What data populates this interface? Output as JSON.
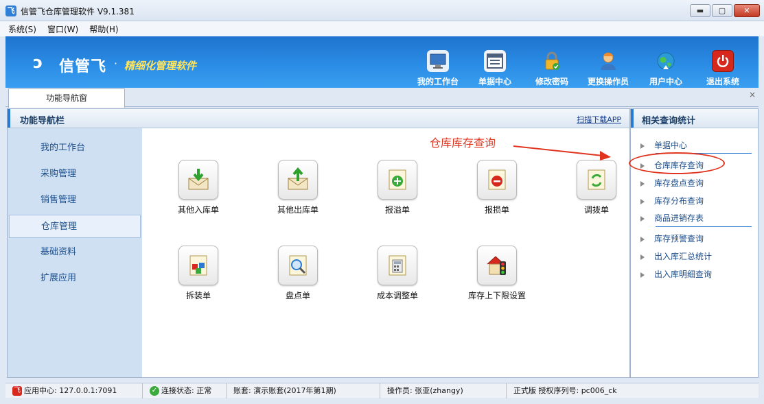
{
  "window": {
    "title": "信管飞仓库管理软件 V9.1.381",
    "controls": {
      "minimize": "▬",
      "maximize": "▢",
      "close": "✕"
    }
  },
  "menu": [
    "系统(S)",
    "窗口(W)",
    "帮助(H)"
  ],
  "banner": {
    "logo": "信管飞",
    "dot": "·",
    "slogan": "精细化管理软件",
    "tools": [
      {
        "label": "我的工作台",
        "icon": "monitor-icon",
        "color": "#3a78c4"
      },
      {
        "label": "单据中心",
        "icon": "document-list-icon",
        "color": "#4c5f7c"
      },
      {
        "label": "修改密码",
        "icon": "lock-icon",
        "color": "#f0b62a"
      },
      {
        "label": "更换操作员",
        "icon": "user-icon",
        "color": "#f08a2a"
      },
      {
        "label": "用户中心",
        "icon": "globe-icon",
        "color": "#2a9bd8"
      },
      {
        "label": "退出系统",
        "icon": "power-icon",
        "color": "#d7281e"
      }
    ]
  },
  "tabs": {
    "active": "功能导航窗",
    "close": "×"
  },
  "nav_panel": {
    "title": "功能导航栏",
    "scan_link": "扫描下载APP",
    "sidebar": [
      "我的工作台",
      "采购管理",
      "销售管理",
      "仓库管理",
      "基础资料",
      "扩展应用"
    ],
    "active_index": 3,
    "functions": [
      {
        "label": "其他入库单",
        "icon": "inbound-icon"
      },
      {
        "label": "其他出库单",
        "icon": "outbound-icon"
      },
      {
        "label": "报溢单",
        "icon": "overflow-icon"
      },
      {
        "label": "报损单",
        "icon": "loss-icon"
      },
      {
        "label": "调拨单",
        "icon": "transfer-icon"
      },
      {
        "label": "拆装单",
        "icon": "assembly-icon"
      },
      {
        "label": "盘点单",
        "icon": "inventory-count-icon"
      },
      {
        "label": "成本调整单",
        "icon": "cost-adjust-icon"
      },
      {
        "label": "库存上下限设置",
        "icon": "stock-limit-icon"
      }
    ]
  },
  "annotation": "仓库库存查询",
  "query_panel": {
    "title": "相关查询统计",
    "links": [
      "单据中心",
      "仓库库存查询",
      "库存盘点查询",
      "库存分布查询",
      "商品进销存表",
      "库存预警查询",
      "出入库汇总统计",
      "出入库明细查询"
    ]
  },
  "status": {
    "app_center": "应用中心: 127.0.0.1:7091",
    "connection": "连接状态: 正常",
    "account": "账套: 演示账套(2017年第1期)",
    "operator": "操作员: 张亚(zhangy)",
    "license": "正式版 授权序列号: pc006_ck"
  }
}
